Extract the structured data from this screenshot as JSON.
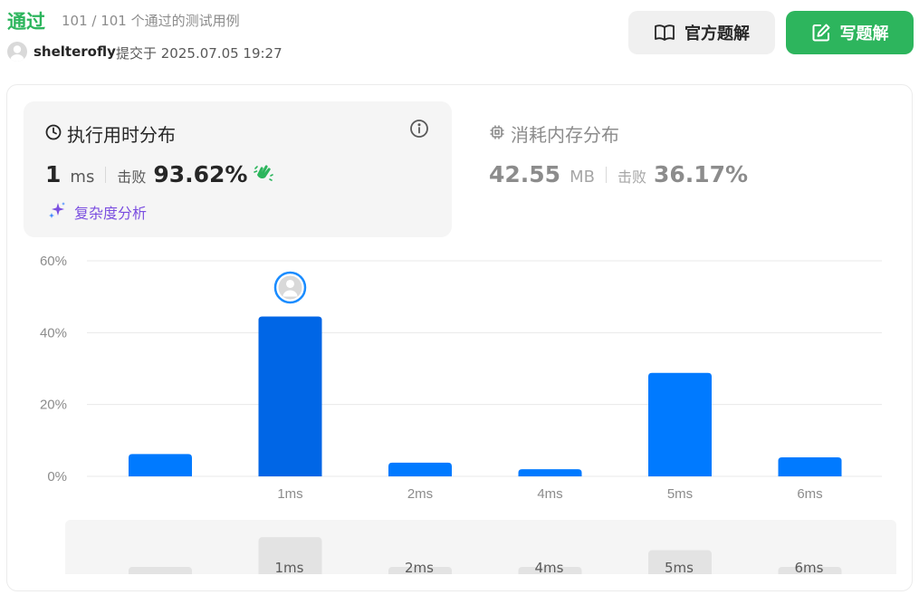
{
  "header": {
    "status": "通过",
    "testcases": "101 / 101 个通过的测试用例",
    "username": "shelterofly",
    "submitted_at": "提交于 2025.07.05 19:27",
    "official_button": "官方题解",
    "write_button": "写题解"
  },
  "runtime": {
    "title": "执行用时分布",
    "value": "1",
    "unit": "ms",
    "beats_label": "击败",
    "beats": "93.62%",
    "complexity_link": "复杂度分析"
  },
  "memory": {
    "title": "消耗内存分布",
    "value": "42.55",
    "unit": "MB",
    "beats_label": "击败",
    "beats": "36.17%"
  },
  "colors": {
    "accepted": "#2db55d",
    "bar": "#007aff",
    "bar_selected": "#0066e6",
    "ai_purple": "#7b4fe0"
  },
  "icons": {
    "official": "book-open-icon",
    "write": "edit-icon",
    "runtime": "clock-icon",
    "memory": "cpu-chip-icon",
    "info": "info-icon",
    "beats": "clap-hands-icon",
    "complexity": "sparkles-icon"
  },
  "chart_data": {
    "type": "bar",
    "y_ticks": [
      "60%",
      "40%",
      "20%",
      "0%"
    ],
    "ylim": [
      0,
      60
    ],
    "bars": [
      {
        "label": "",
        "value": 6.2
      },
      {
        "label": "1ms",
        "value": 44.5,
        "selected": true
      },
      {
        "label": "2ms",
        "value": 3.8
      },
      {
        "label": "4ms",
        "value": 2.0
      },
      {
        "label": "5ms",
        "value": 28.8
      },
      {
        "label": "6ms",
        "value": 5.3
      }
    ],
    "minimap": [
      {
        "label": "",
        "value": 6.2
      },
      {
        "label": "1ms",
        "value": 44.5
      },
      {
        "label": "2ms",
        "value": 3.8
      },
      {
        "label": "4ms",
        "value": 2.0
      },
      {
        "label": "5ms",
        "value": 28.8
      },
      {
        "label": "6ms",
        "value": 5.3
      }
    ]
  }
}
